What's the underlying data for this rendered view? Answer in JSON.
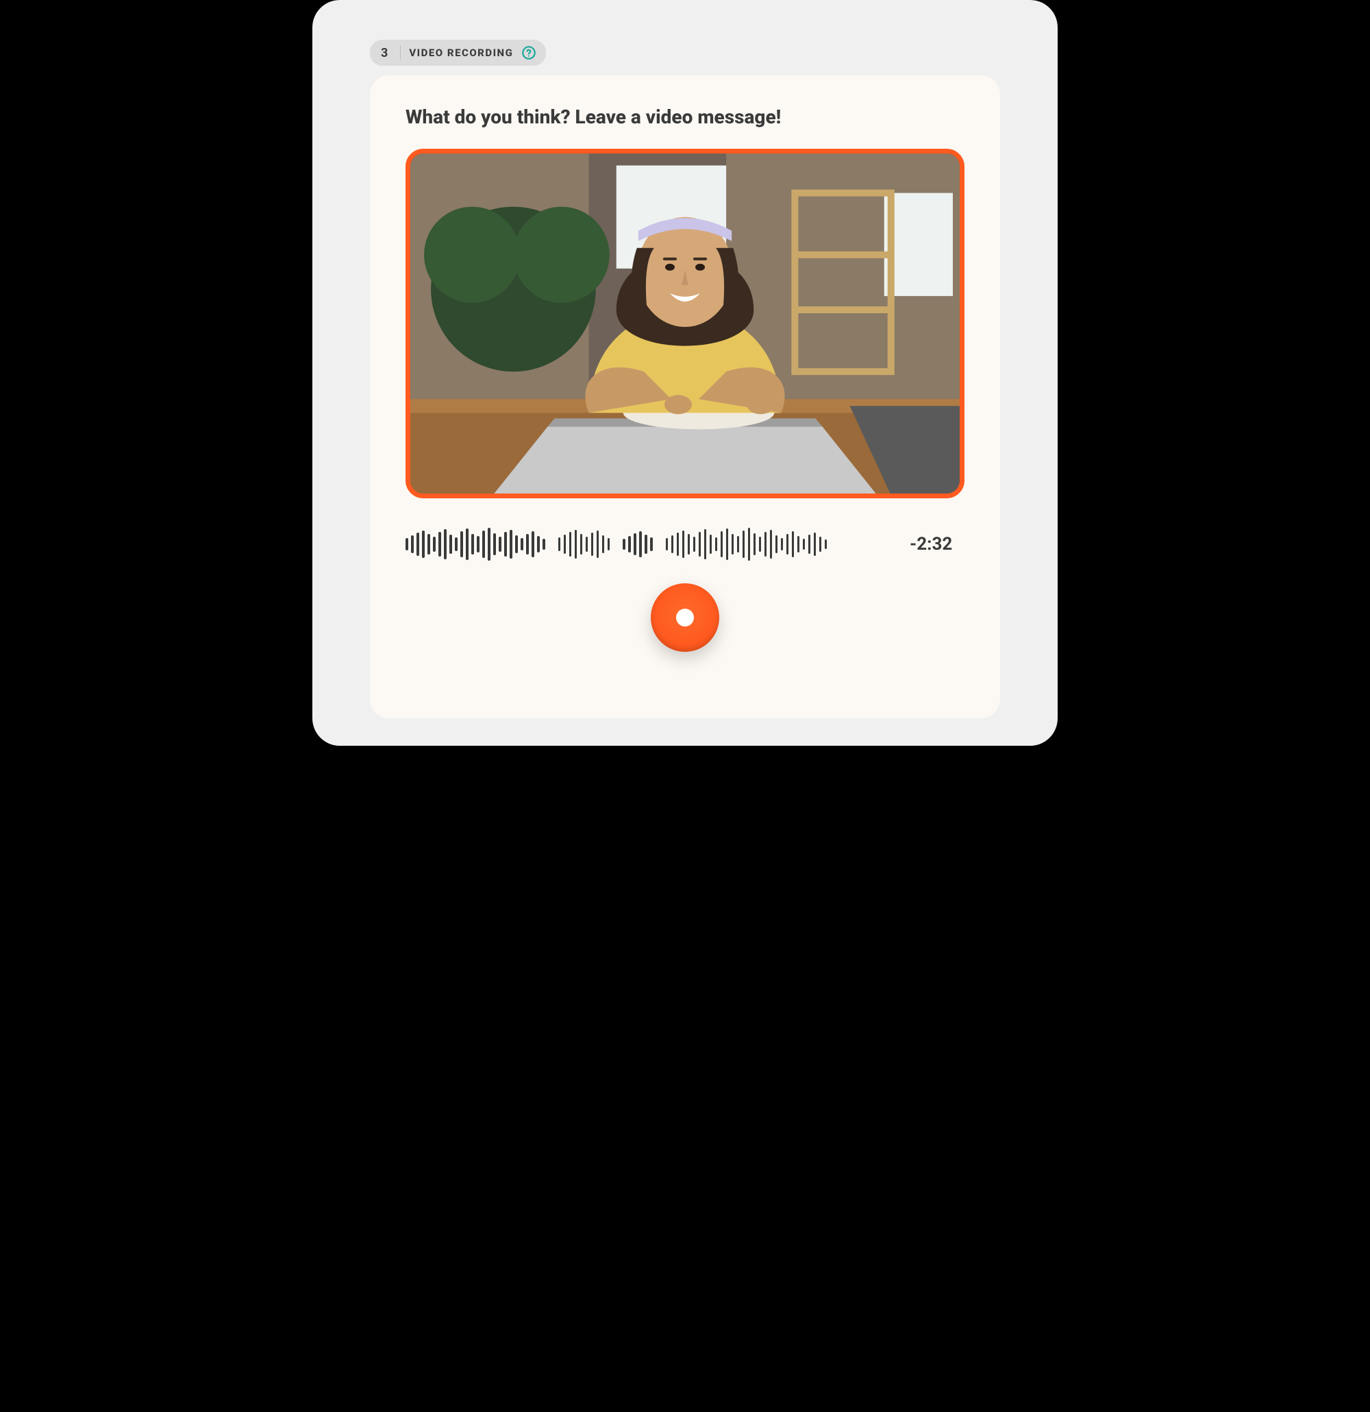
{
  "header": {
    "step_number": "3",
    "label": "VIDEO RECORDING"
  },
  "prompt": {
    "title": "What do you think? Leave a video message!"
  },
  "timer": {
    "remaining": "-2:32"
  },
  "colors": {
    "accent": "#ff5a1f",
    "card_bg": "#fcf9f4",
    "panel_bg": "#f0f0f0",
    "text": "#3a3a3a",
    "help_icon": "#1aa79c"
  },
  "icons": {
    "help": "question-circle-icon",
    "record": "record-icon"
  }
}
